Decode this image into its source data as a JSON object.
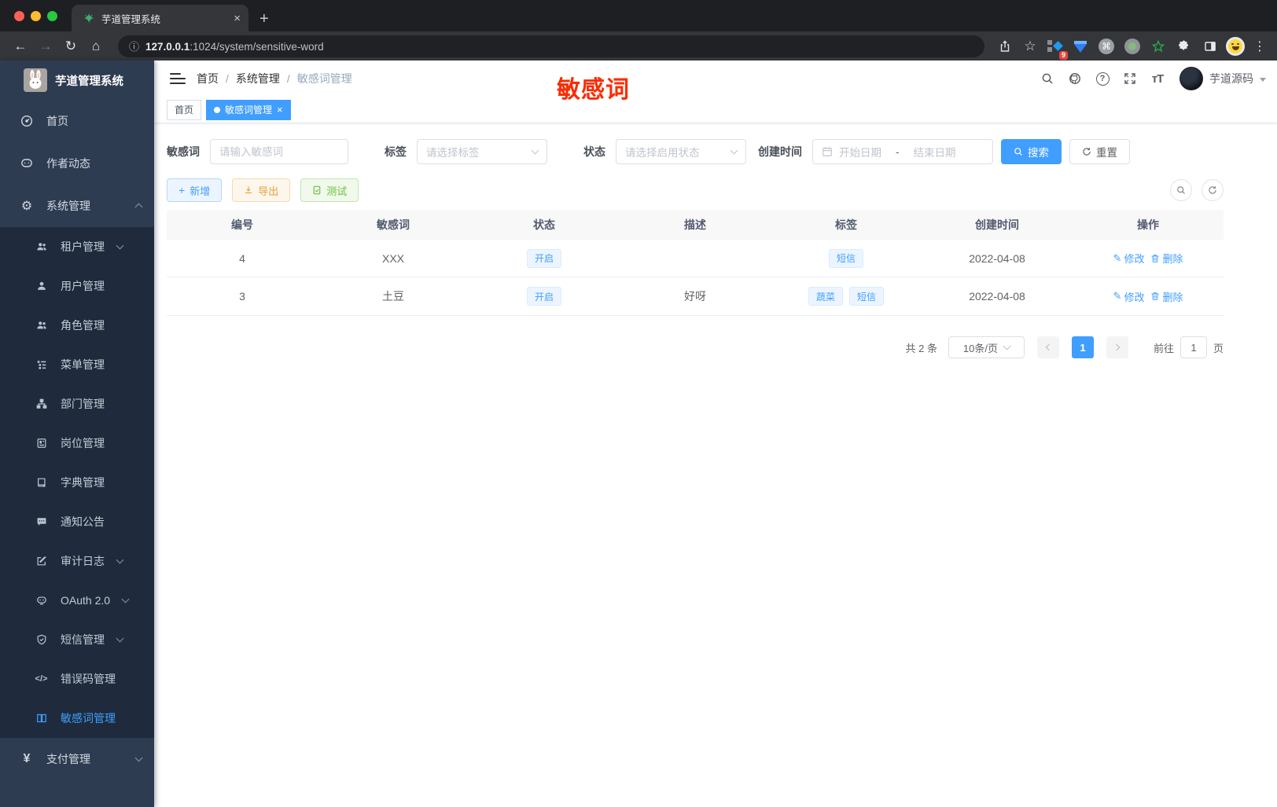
{
  "colors": {
    "accent": "#409eff",
    "annotation_red": "#fb2b01",
    "sidebar_bg": "#2e3c51",
    "submenu_bg": "#1f2b3c",
    "tag_bg": "#ecf5ff"
  },
  "browser": {
    "tab_title": "芋道管理系统",
    "url_host": "127.0.0.1",
    "url_rest": ":1024/system/sensitive-word",
    "ext_badge": "9"
  },
  "icons": {
    "back": "←",
    "forward": "→",
    "reload": "↻",
    "home": "⌂",
    "info": "ⓘ",
    "star": "☆",
    "dots": "⋮",
    "command": "⌘",
    "close": "×",
    "newtab": "+",
    "plus": "+",
    "gear": "⚙",
    "yen": "¥",
    "code": "</>",
    "pencil": "✎",
    "question": "?",
    "font_size": "тT"
  },
  "sidebar": {
    "logo_title": "芋道管理系统",
    "top_items": [
      "首页",
      "作者动态",
      "系统管理"
    ],
    "sub_items": [
      "租户管理",
      "用户管理",
      "角色管理",
      "菜单管理",
      "部门管理",
      "岗位管理",
      "字典管理",
      "通知公告",
      "审计日志",
      "OAuth 2.0",
      "短信管理",
      "错误码管理",
      "敏感词管理"
    ],
    "bottom_items": [
      "支付管理"
    ]
  },
  "navbar": {
    "breadcrumb": [
      "首页",
      "系统管理",
      "敏感词管理"
    ],
    "separator": "/",
    "username": "芋道源码",
    "annotation": "敏感词"
  },
  "tags": [
    {
      "label": "首页"
    },
    {
      "label": "敏感词管理"
    }
  ],
  "filters": {
    "keyword_label": "敏感词",
    "keyword_placeholder": "请输入敏感词",
    "tag_label": "标签",
    "tag_placeholder": "请选择标签",
    "status_label": "状态",
    "status_placeholder": "请选择启用状态",
    "date_label": "创建时间",
    "date_start": "开始日期",
    "date_separator": "-",
    "date_end": "结束日期",
    "search_label": "搜索",
    "reset_label": "重置"
  },
  "toolbar": {
    "add_label": "新增",
    "export_label": "导出",
    "test_label": "测试"
  },
  "table": {
    "columns": [
      "编号",
      "敏感词",
      "状态",
      "描述",
      "标签",
      "创建时间",
      "操作"
    ],
    "rows": [
      {
        "id": "4",
        "word": "XXX",
        "status": "开启",
        "desc": "",
        "tags": [
          "短信"
        ],
        "created": "2022-04-08",
        "edit": "修改",
        "delete": "删除"
      },
      {
        "id": "3",
        "word": "土豆",
        "status": "开启",
        "desc": "好呀",
        "tags": [
          "蔬菜",
          "短信"
        ],
        "created": "2022-04-08",
        "edit": "修改",
        "delete": "删除"
      }
    ]
  },
  "pagination": {
    "total": "共 2 条",
    "page_size": "10条/页",
    "current_page": "1",
    "goto_prefix": "前往",
    "goto_value": "1",
    "goto_suffix": "页"
  }
}
